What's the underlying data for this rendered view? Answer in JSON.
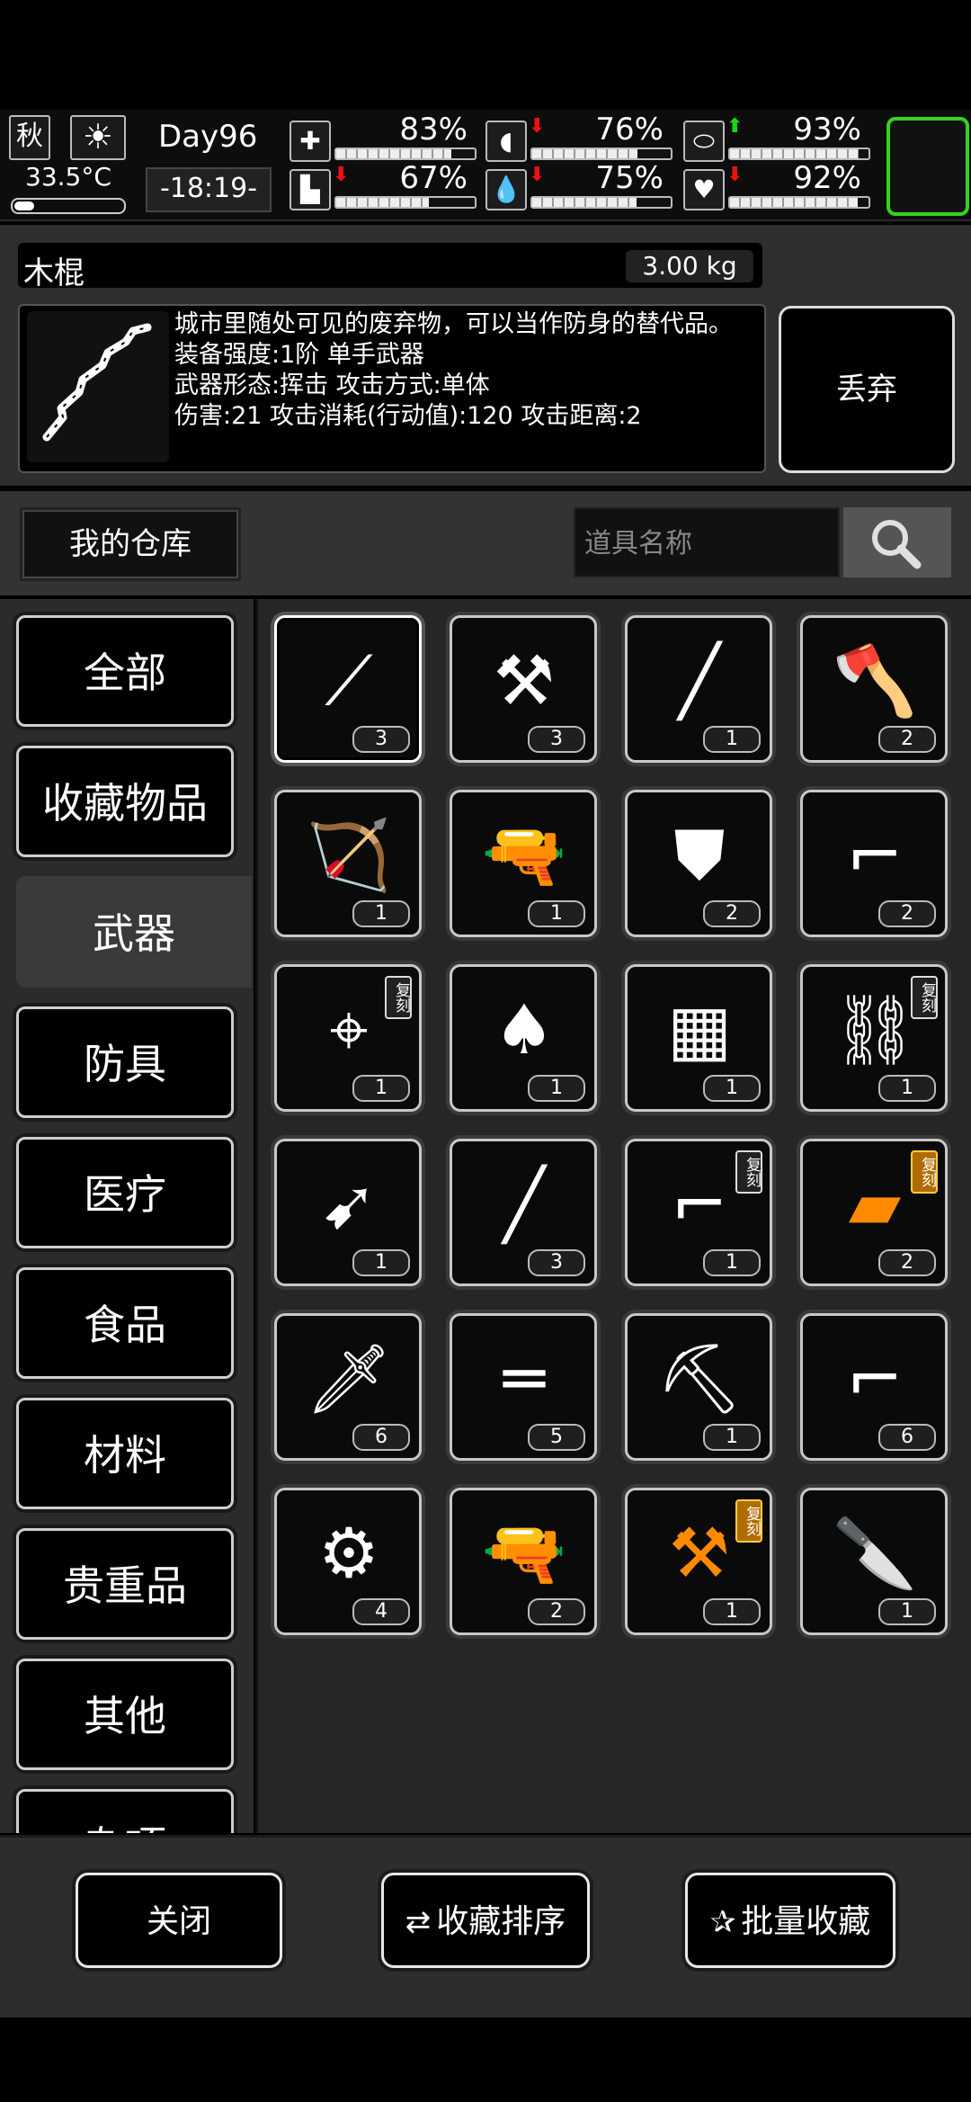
{
  "status": {
    "season": "秋",
    "weather_icon": "sun-icon",
    "temperature": "33.5°C",
    "temperature_level": 0.2,
    "day": "Day96",
    "time": "-18:19-",
    "stats": [
      {
        "icon": "medkit-icon",
        "glyph": "✚",
        "value": "83%",
        "level": 0.83,
        "arrow": ""
      },
      {
        "icon": "stomach-icon",
        "glyph": "◖",
        "value": "76%",
        "level": 0.76,
        "arrow": "down"
      },
      {
        "icon": "pill-icon",
        "glyph": "⬭",
        "value": "93%",
        "level": 0.93,
        "arrow": "up"
      },
      {
        "icon": "boot-icon",
        "glyph": "▙",
        "value": "67%",
        "level": 0.67,
        "arrow": "down"
      },
      {
        "icon": "water-drop-icon",
        "glyph": "💧",
        "value": "75%",
        "level": 0.75,
        "arrow": "down"
      },
      {
        "icon": "heart-icon",
        "glyph": "♥",
        "value": "92%",
        "level": 0.92,
        "arrow": "down"
      }
    ]
  },
  "detail": {
    "name": "木棍",
    "weight": "3.00 kg",
    "description": "城市里随处可见的废弃物，可以当作防身的替代品。\n装备强度:1阶 单手武器\n武器形态:挥击 攻击方式:单体\n 伤害:21 攻击消耗(行动值):120 攻击距离:2",
    "discard_label": "丢弃"
  },
  "warehouse": {
    "tab_label": "我的仓库",
    "search_placeholder": "道具名称"
  },
  "categories": [
    "全部",
    "收藏物品",
    "武器",
    "防具",
    "医疗",
    "食品",
    "材料",
    "贵重品",
    "其他",
    "杂项"
  ],
  "active_category": "武器",
  "items": [
    {
      "icon": "wooden-stick-icon",
      "glyph": "⟋",
      "count": "3",
      "replica": false,
      "gold": false
    },
    {
      "icon": "hammer-icon",
      "glyph": "⚒",
      "count": "3",
      "replica": false,
      "gold": false
    },
    {
      "icon": "baseball-bat-icon",
      "glyph": "╱",
      "count": "1",
      "replica": false,
      "gold": false
    },
    {
      "icon": "axe-icon",
      "glyph": "🪓",
      "count": "2",
      "replica": false,
      "gold": false
    },
    {
      "icon": "compound-bow-icon",
      "glyph": "🏹",
      "count": "1",
      "replica": false,
      "gold": false
    },
    {
      "icon": "revolver-icon",
      "glyph": "🔫",
      "count": "1",
      "replica": false,
      "gold": false
    },
    {
      "icon": "riot-shield-icon",
      "glyph": "⛊",
      "count": "2",
      "replica": false,
      "gold": false
    },
    {
      "icon": "assault-rifle-icon",
      "glyph": "⌐",
      "count": "2",
      "replica": false,
      "gold": false
    },
    {
      "icon": "sniper-rifle-icon",
      "glyph": "⌖",
      "count": "1",
      "replica": true,
      "gold": false
    },
    {
      "icon": "shovel-icon",
      "glyph": "♠",
      "count": "1",
      "replica": false,
      "gold": false
    },
    {
      "icon": "ballistic-shield-icon",
      "glyph": "▦",
      "count": "1",
      "replica": false,
      "gold": false
    },
    {
      "icon": "chain-whip-icon",
      "glyph": "⛓",
      "count": "1",
      "replica": true,
      "gold": false
    },
    {
      "icon": "rocket-launcher-icon",
      "glyph": "➹",
      "count": "1",
      "replica": false,
      "gold": false
    },
    {
      "icon": "screwdriver-icon",
      "glyph": "╱",
      "count": "3",
      "replica": false,
      "gold": false
    },
    {
      "icon": "sci-fi-rifle-icon",
      "glyph": "⌐",
      "count": "1",
      "replica": true,
      "gold": false
    },
    {
      "icon": "golden-blaster-icon",
      "glyph": "▰",
      "count": "2",
      "replica": true,
      "gold": true
    },
    {
      "icon": "broadsword-icon",
      "glyph": "🗡",
      "count": "6",
      "replica": false,
      "gold": false
    },
    {
      "icon": "shotgun-icon",
      "glyph": "═",
      "count": "5",
      "replica": false,
      "gold": false
    },
    {
      "icon": "nail-gun-icon",
      "glyph": "⛏",
      "count": "1",
      "replica": false,
      "gold": false
    },
    {
      "icon": "rifle-icon",
      "glyph": "⌐",
      "count": "6",
      "replica": false,
      "gold": false
    },
    {
      "icon": "chainsaw-icon",
      "glyph": "⚙",
      "count": "4",
      "replica": false,
      "gold": false
    },
    {
      "icon": "pistol-icon",
      "glyph": "🔫",
      "count": "2",
      "replica": false,
      "gold": false
    },
    {
      "icon": "golden-hammer-icon",
      "glyph": "⚒",
      "count": "1",
      "replica": true,
      "gold": true
    },
    {
      "icon": "machete-icon",
      "glyph": "🔪",
      "count": "1",
      "replica": false,
      "gold": false
    }
  ],
  "replica_label": "复刻",
  "actions": {
    "close_label": "关闭",
    "sort_label": "收藏排序",
    "sort_icon": "swap-arrows-icon",
    "batch_label": "批量收藏",
    "batch_icon": "stars-icon"
  },
  "colors": {
    "highlight_green": "#35d21f",
    "arrow_down": "#e11111",
    "arrow_up": "#11dd11",
    "gold_item": "#ff8a00"
  }
}
